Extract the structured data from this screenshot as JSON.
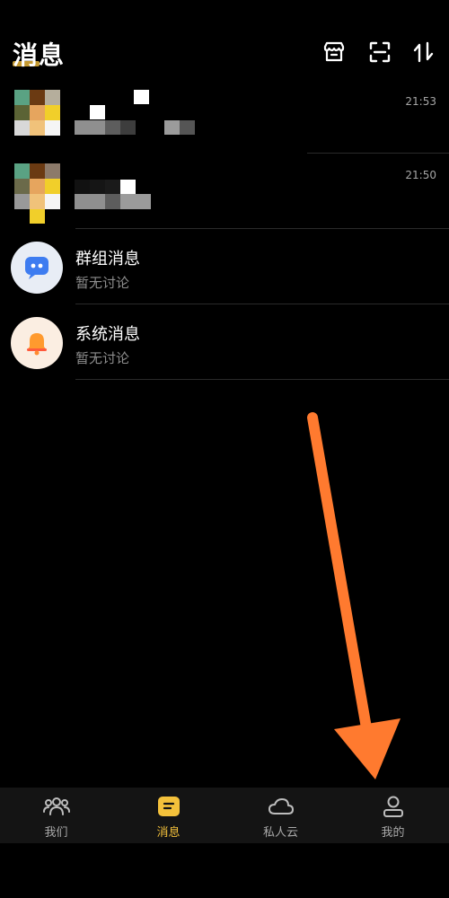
{
  "header": {
    "title": "消息",
    "icons": [
      "store-icon",
      "scan-icon",
      "sort-icon"
    ]
  },
  "conversations": [
    {
      "time": "21:53"
    },
    {
      "time": "21:50"
    }
  ],
  "group_message": {
    "name": "群组消息",
    "subtitle": "暂无讨论",
    "icon": "group-chat-icon"
  },
  "system_message": {
    "name": "系统消息",
    "subtitle": "暂无讨论",
    "icon": "bell-icon"
  },
  "bottom_nav": {
    "items": [
      {
        "label": "我们",
        "icon": "people-icon"
      },
      {
        "label": "消息",
        "icon": "message-icon",
        "active": true
      },
      {
        "label": "私人云",
        "icon": "cloud-icon"
      },
      {
        "label": "我的",
        "icon": "profile-icon"
      }
    ]
  },
  "colors": {
    "accent": "#f4c13b",
    "background": "#000000",
    "annotation_arrow": "#ff7a2f"
  }
}
